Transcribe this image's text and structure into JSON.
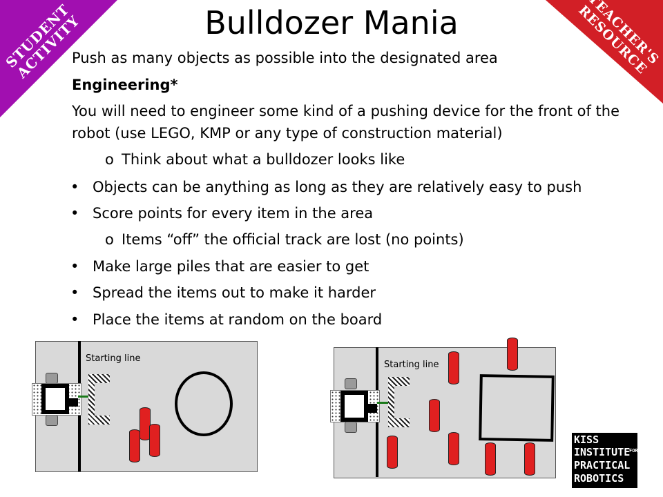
{
  "badges": {
    "student": "STUDENT ACTIVITY",
    "teacher": "TEACHER'S RESOURCE"
  },
  "title": "Bulldozer Mania",
  "subtitle": "Push as many objects as possible into the designated area",
  "engineering_heading": "Engineering*",
  "engineering_text_1": "You will need to engineer some kind of a pushing device for the front of the",
  "engineering_text_2": "robot (use LEGO, KMP or any type of construction material)",
  "sub_think": "Think about what a bulldozer looks like",
  "bullets": [
    "Objects can be anything as long as they are relatively easy to push",
    "Score points for every item in the area",
    "Make large piles that are easier to get",
    "Spread the items out to make it harder",
    "Place the items at random on the board"
  ],
  "sub_off": "Items “off” the official track are lost (no points)",
  "bullet_symbol": "•",
  "sub_symbol": "o",
  "diagram_left": {
    "start_label": "Starting line"
  },
  "diagram_right": {
    "start_label": "Starting line"
  },
  "logo": {
    "line1": "KISS",
    "line2": "INSTITUTE",
    "line2_small": "FOR",
    "line3": "PRACTICAL",
    "line4": "ROBOTICS"
  },
  "colors": {
    "student_badge": "#a10fb0",
    "teacher_badge": "#d21f26",
    "objects": "#e02020",
    "pusher_arm": "#1a7a1a",
    "board": "#d9d9d9"
  }
}
